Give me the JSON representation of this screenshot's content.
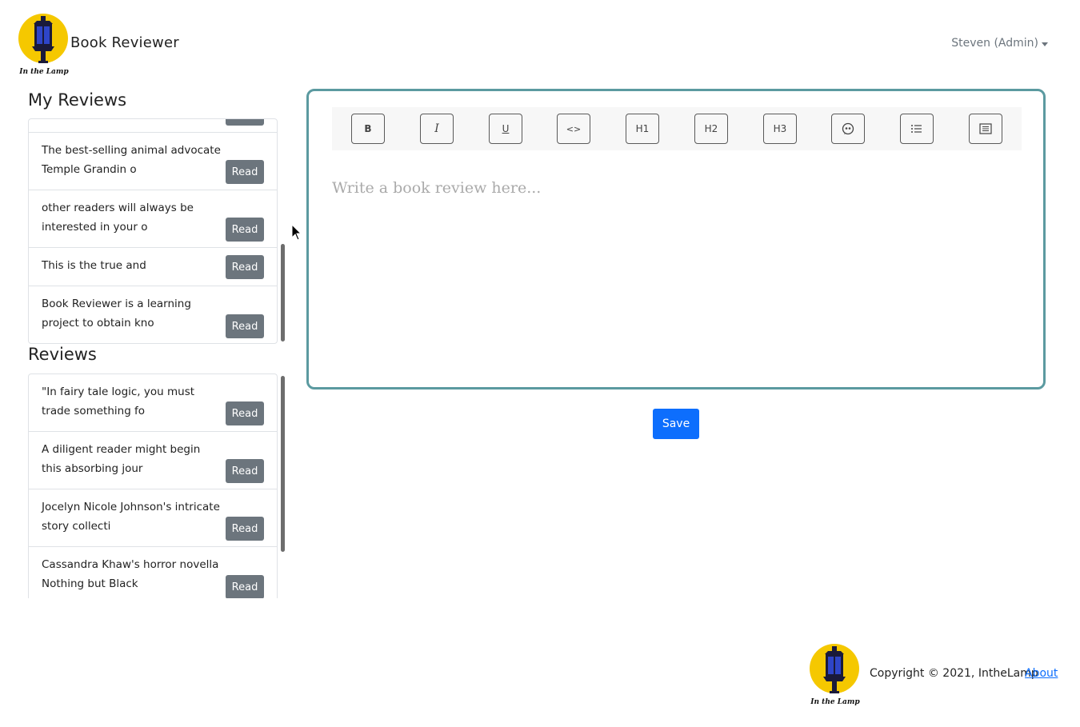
{
  "header": {
    "brand": "Book Reviewer",
    "logo_text": "In the Lamp",
    "user_menu": "Steven (Admin)"
  },
  "my_reviews": {
    "title": "My Reviews",
    "items": [
      {
        "text": "The best-selling animal advocate Temple Grandin o",
        "button": "Read"
      },
      {
        "text": "other readers will always be interested in your o",
        "button": "Read"
      },
      {
        "text": "This is the true and",
        "button": "Read"
      },
      {
        "text": "Book Reviewer is a learning project to obtain kno",
        "button": "Read"
      }
    ]
  },
  "reviews": {
    "title": "Reviews",
    "items": [
      {
        "text": "\"In fairy tale logic, you must trade something fo",
        "button": "Read"
      },
      {
        "text": "A diligent reader might begin this absorbing jour",
        "button": "Read"
      },
      {
        "text": "Jocelyn Nicole Johnson's intricate story collecti",
        "button": "Read"
      },
      {
        "text": "Cassandra Khaw's horror novella Nothing but Black",
        "button": "Read"
      }
    ]
  },
  "editor": {
    "toolbar": [
      "B",
      "I",
      "U",
      "<>",
      "H1",
      "H2",
      "H3",
      "quote-icon",
      "list-icon",
      "block-icon"
    ],
    "placeholder": "Write a book review here..."
  },
  "save_label": "Save",
  "footer": {
    "logo_text": "In the Lamp",
    "copyright": "Copyright © 2021, IntheLamp",
    "about": "About"
  },
  "colors": {
    "logo_yellow": "#f5c800",
    "lamp_dark": "#1a1a3a",
    "editor_border": "#5b9aa0",
    "save_blue": "#0d6efd",
    "read_gray": "#6c757d"
  }
}
